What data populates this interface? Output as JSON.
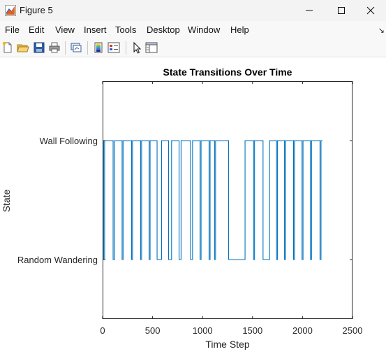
{
  "window": {
    "title": "Figure 5",
    "controls": [
      "minimize-icon",
      "maximize-icon",
      "close-icon"
    ]
  },
  "menu": {
    "items": [
      "File",
      "Edit",
      "View",
      "Insert",
      "Tools",
      "Desktop",
      "Window",
      "Help"
    ],
    "overflow": "↘"
  },
  "toolbar": {
    "icons": [
      "new-figure-icon",
      "open-file-icon",
      "save-icon",
      "print-icon",
      "link-plot-icon",
      "colorbar-icon",
      "legend-icon",
      "edit-plot-icon",
      "property-editor-icon"
    ]
  },
  "colors": {
    "line": "#0072bd",
    "axes": "#262626",
    "titlebar": "#f3f3f3"
  },
  "chart_data": {
    "type": "line",
    "title": "State Transitions Over Time",
    "xlabel": "Time Step",
    "ylabel": "State",
    "xlim": [
      0,
      2500
    ],
    "ylim": [
      0.5,
      2.5
    ],
    "xticks": [
      0,
      500,
      1000,
      1500,
      2000,
      2500
    ],
    "xtick_labels": [
      "0",
      "500",
      "1000",
      "1500",
      "2000",
      "2500"
    ],
    "yticks": [
      1,
      2
    ],
    "ytick_labels": [
      "Random Wandering",
      "Wall Following"
    ],
    "grid": false,
    "series": [
      {
        "style": "step",
        "start_value": 2,
        "end_x": 2200,
        "transitions": [
          {
            "x": 10,
            "to": 1
          },
          {
            "x": 20,
            "to": 2
          },
          {
            "x": 105,
            "to": 1
          },
          {
            "x": 120,
            "to": 2
          },
          {
            "x": 195,
            "to": 1
          },
          {
            "x": 205,
            "to": 2
          },
          {
            "x": 290,
            "to": 1
          },
          {
            "x": 300,
            "to": 2
          },
          {
            "x": 380,
            "to": 1
          },
          {
            "x": 390,
            "to": 2
          },
          {
            "x": 465,
            "to": 1
          },
          {
            "x": 475,
            "to": 2
          },
          {
            "x": 545,
            "to": 1
          },
          {
            "x": 590,
            "to": 2
          },
          {
            "x": 660,
            "to": 1
          },
          {
            "x": 690,
            "to": 2
          },
          {
            "x": 765,
            "to": 1
          },
          {
            "x": 785,
            "to": 2
          },
          {
            "x": 880,
            "to": 1
          },
          {
            "x": 900,
            "to": 2
          },
          {
            "x": 975,
            "to": 1
          },
          {
            "x": 985,
            "to": 2
          },
          {
            "x": 1065,
            "to": 1
          },
          {
            "x": 1075,
            "to": 2
          },
          {
            "x": 1120,
            "to": 1
          },
          {
            "x": 1130,
            "to": 2
          },
          {
            "x": 1260,
            "to": 1
          },
          {
            "x": 1425,
            "to": 2
          },
          {
            "x": 1510,
            "to": 1
          },
          {
            "x": 1520,
            "to": 2
          },
          {
            "x": 1605,
            "to": 1
          },
          {
            "x": 1670,
            "to": 2
          },
          {
            "x": 1740,
            "to": 1
          },
          {
            "x": 1750,
            "to": 2
          },
          {
            "x": 1820,
            "to": 1
          },
          {
            "x": 1830,
            "to": 2
          },
          {
            "x": 1910,
            "to": 1
          },
          {
            "x": 1920,
            "to": 2
          },
          {
            "x": 1995,
            "to": 1
          },
          {
            "x": 2005,
            "to": 2
          },
          {
            "x": 2080,
            "to": 1
          },
          {
            "x": 2090,
            "to": 2
          },
          {
            "x": 2175,
            "to": 1
          },
          {
            "x": 2185,
            "to": 2
          }
        ]
      }
    ]
  }
}
